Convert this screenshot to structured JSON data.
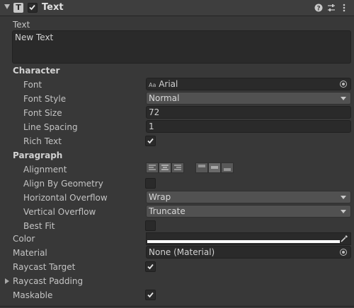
{
  "header": {
    "title": "Text",
    "component_icon": "T"
  },
  "text_label": "Text",
  "text_value": "New Text",
  "sections": {
    "character": "Character",
    "paragraph": "Paragraph"
  },
  "character": {
    "font": {
      "label": "Font",
      "value": "Arial",
      "prefix": "Aa"
    },
    "font_style": {
      "label": "Font Style",
      "value": "Normal"
    },
    "font_size": {
      "label": "Font Size",
      "value": "72"
    },
    "line_spacing": {
      "label": "Line Spacing",
      "value": "1"
    },
    "rich_text": {
      "label": "Rich Text",
      "checked": true
    }
  },
  "paragraph": {
    "alignment": {
      "label": "Alignment",
      "horizontal": [
        "left",
        "center",
        "right"
      ],
      "vertical": [
        "top",
        "middle",
        "bottom"
      ]
    },
    "align_by_geometry": {
      "label": "Align By Geometry",
      "checked": false
    },
    "horizontal_overflow": {
      "label": "Horizontal Overflow",
      "value": "Wrap"
    },
    "vertical_overflow": {
      "label": "Vertical Overflow",
      "value": "Truncate"
    },
    "best_fit": {
      "label": "Best Fit",
      "checked": false
    }
  },
  "color": {
    "label": "Color",
    "value": "#ffffff"
  },
  "material": {
    "label": "Material",
    "value": "None (Material)"
  },
  "raycast_target": {
    "label": "Raycast Target",
    "checked": true
  },
  "raycast_padding": {
    "label": "Raycast Padding"
  },
  "maskable": {
    "label": "Maskable",
    "checked": true
  },
  "colors": {
    "background": "#383838",
    "field": "#2a2a2a",
    "dropdown": "#515151"
  }
}
